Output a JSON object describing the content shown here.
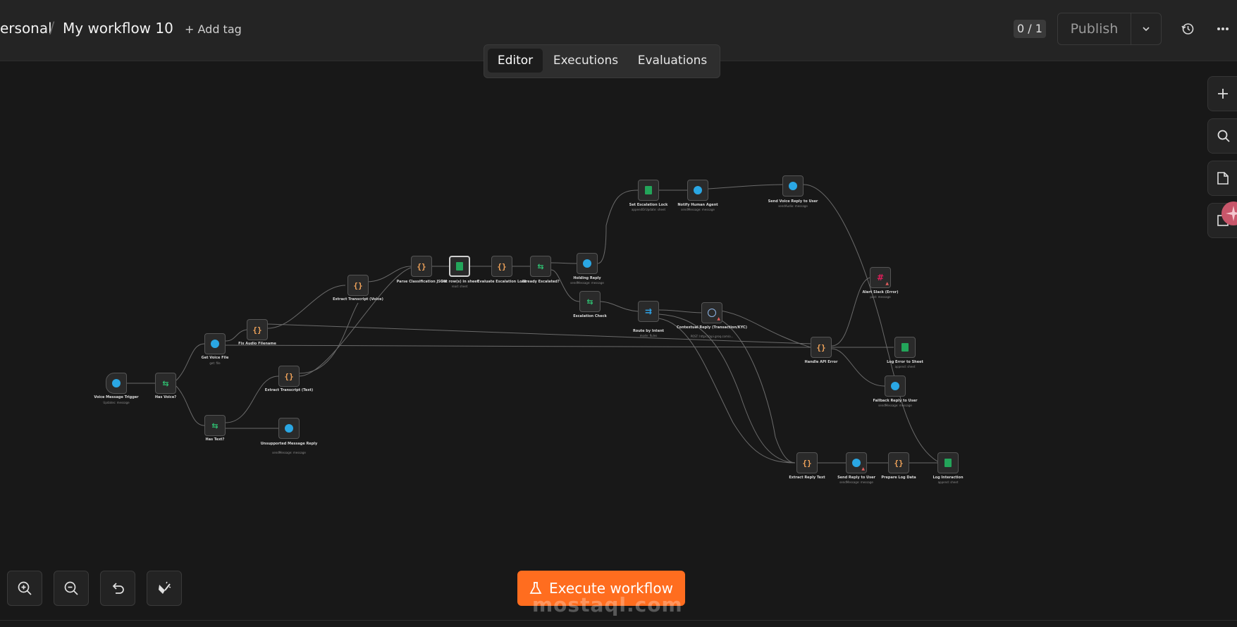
{
  "header": {
    "breadcrumb_project": "ersonal",
    "workflow_name": "My workflow 10",
    "add_tag": "+ Add tag",
    "version_counter": "0 / 1",
    "publish_label": "Publish"
  },
  "tabs": [
    {
      "label": "Editor",
      "active": true
    },
    {
      "label": "Executions",
      "active": false
    },
    {
      "label": "Evaluations",
      "active": false
    }
  ],
  "right_toolbar": [
    "plus-icon",
    "search-icon",
    "sticky-note-icon",
    "panel-icon"
  ],
  "bottom_toolbar": [
    "zoom-in-icon",
    "zoom-out-icon",
    "reset-zoom-icon",
    "tidy-up-icon"
  ],
  "execute_label": "Execute workflow",
  "watermark": "mostaql.com",
  "colors": {
    "accent": "#ff6d1f",
    "telegram": "#2aa7e4",
    "sheets": "#23a55a",
    "code": "#f0a35a",
    "if": "#2fbf71",
    "error": "#e35d5d"
  },
  "nodes": [
    {
      "id": "voice_trigger",
      "label": "Voice Message Trigger",
      "sub": "Updates: message",
      "icon": "telegram"
    },
    {
      "id": "has_voice",
      "label": "Has Voice?",
      "sub": "",
      "icon": "if"
    },
    {
      "id": "get_voice",
      "label": "Get Voice File",
      "sub": "get: file",
      "icon": "telegram"
    },
    {
      "id": "fix_audio",
      "label": "Fix Audio Filename",
      "sub": "",
      "icon": "code"
    },
    {
      "id": "has_text",
      "label": "Has Text?",
      "sub": "",
      "icon": "if"
    },
    {
      "id": "extract_text",
      "label": "Extract Transcript (Text)",
      "sub": "",
      "icon": "code"
    },
    {
      "id": "unsupported",
      "label": "Unsupported Message Reply",
      "sub": "sendMessage: message",
      "icon": "telegram"
    },
    {
      "id": "extract_voice",
      "label": "Extract Transcript (Voice)",
      "sub": "",
      "icon": "code"
    },
    {
      "id": "parse_json",
      "label": "Parse Classification JSON",
      "sub": "",
      "icon": "code"
    },
    {
      "id": "get_rows",
      "label": "Get row(s) in sheet",
      "sub": "read: sheet",
      "icon": "sheets"
    },
    {
      "id": "eval_lock",
      "label": "Evaluate Escalation Lock",
      "sub": "",
      "icon": "code"
    },
    {
      "id": "already_esc",
      "label": "Already Escalated?",
      "sub": "",
      "icon": "if"
    },
    {
      "id": "holding",
      "label": "Holding Reply",
      "sub": "sendMessage: message",
      "icon": "telegram"
    },
    {
      "id": "esc_check",
      "label": "Escalation Check",
      "sub": "",
      "icon": "if"
    },
    {
      "id": "set_lock",
      "label": "Set Escalation Lock",
      "sub": "appendOrUpdate: sheet",
      "icon": "sheets"
    },
    {
      "id": "notify",
      "label": "Notify Human Agent",
      "sub": "sendMessage: message",
      "icon": "telegram"
    },
    {
      "id": "send_voice",
      "label": "Send Voice Reply to User",
      "sub": "sendAudio: message",
      "icon": "telegram"
    },
    {
      "id": "route",
      "label": "Route by Intent",
      "sub": "mode: Rules",
      "icon": "switch"
    },
    {
      "id": "contextual",
      "label": "Contextual Reply (Transaction/KYC)",
      "sub": "POST: https://api.groq.com/o...",
      "icon": "http"
    },
    {
      "id": "alert_slack",
      "label": "Alert Slack (Error)",
      "sub": "post: message",
      "icon": "slack"
    },
    {
      "id": "handle_err",
      "label": "Handle API Error",
      "sub": "",
      "icon": "code"
    },
    {
      "id": "log_err",
      "label": "Log Error to Sheet",
      "sub": "append: sheet",
      "icon": "sheets"
    },
    {
      "id": "fallback",
      "label": "Fallback Reply to User",
      "sub": "sendMessage: message",
      "icon": "telegram"
    },
    {
      "id": "extract_reply",
      "label": "Extract Reply Text",
      "sub": "",
      "icon": "code"
    },
    {
      "id": "send_reply",
      "label": "Send Reply to User",
      "sub": "sendMessage: message",
      "icon": "telegram"
    },
    {
      "id": "prep_log",
      "label": "Prepare Log Data",
      "sub": "",
      "icon": "code"
    },
    {
      "id": "log_interaction",
      "label": "Log Interaction",
      "sub": "append: sheet",
      "icon": "sheets"
    }
  ]
}
